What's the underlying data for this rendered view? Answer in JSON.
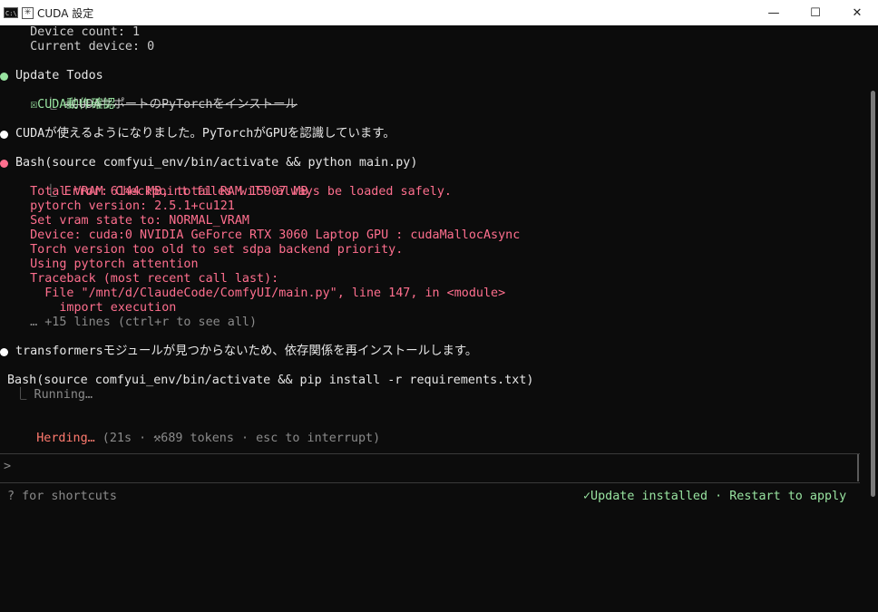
{
  "window": {
    "title": "CUDA 設定",
    "minimize": "—",
    "maximize": "☐",
    "close": "✕"
  },
  "colors": {
    "success": "#98e3a0",
    "error": "#ff6f8e",
    "herding": "#ff7a6e",
    "dim": "#8a8a8a",
    "text": "#cccccc"
  },
  "terminal": {
    "l1": "  Device count: 1",
    "l2": "  Current device: 0",
    "todos_title": "Update Todos",
    "todo1_prefix": "⎿ ",
    "todo1": "☒CUDAサポートのPyTorchをインストール",
    "todo2": "  ☒CUDA動作確認",
    "cuda_msg": "CUDAが使えるようになりました。PyTorchがGPUを認識しています。",
    "bash1": "Bash(source comfyui_env/bin/activate && python main.py)",
    "err_prefix": "⎿ ",
    "e1": "Error: Checkpoint files will always be loaded safely.",
    "e2": "  Total VRAM 6144 MB, total RAM 15907 MB",
    "e3": "  pytorch version: 2.5.1+cu121",
    "e4": "  Set vram state to: NORMAL_VRAM",
    "e5": "  Device: cuda:0 NVIDIA GeForce RTX 3060 Laptop GPU : cudaMallocAsync",
    "e6": "  Torch version too old to set sdpa backend priority.",
    "e7": "  Using pytorch attention",
    "e8": "  Traceback (most recent call last):",
    "e9": "    File \"/mnt/d/ClaudeCode/ComfyUI/main.py\", line 147, in <module>",
    "e10": "      import execution",
    "more": "  … +15 lines (ctrl+r to see all)",
    "transformers_msg": "transformersモジュールが見つからないため、依存関係を再インストールします。",
    "bash2": "Bash(source comfyui_env/bin/activate && pip install -r requirements.txt)",
    "running": " ⎿ Running…",
    "herding": "Herding…",
    "herding_stats": " (21s · ⚒689 tokens · esc to interrupt)",
    "prompt": ">",
    "shortcuts": "? for shortcuts",
    "update": "✓Update installed · Restart to apply"
  }
}
